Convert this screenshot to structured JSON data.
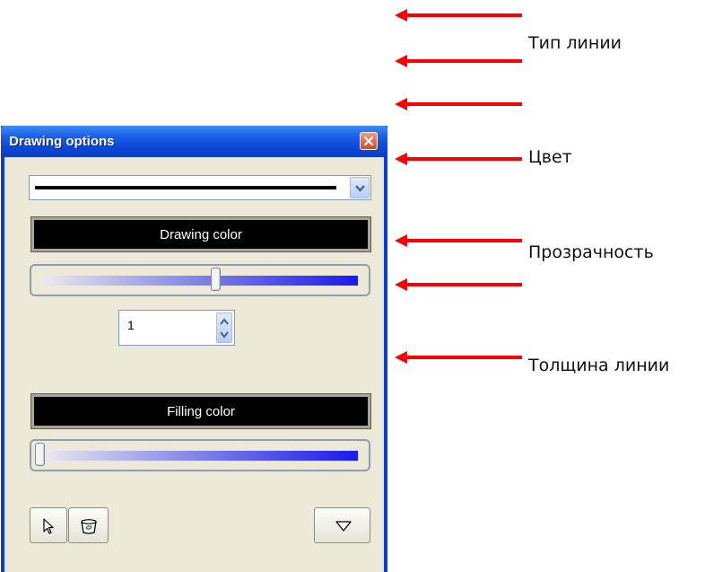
{
  "annotations": {
    "line_type": "Тип линии",
    "color": "Цвет",
    "transparency": "Прозрачность",
    "line_thickness": "Толщина линии",
    "arrow_color": "#ff0000"
  },
  "window": {
    "title": "Drawing options",
    "close_icon": "close-icon"
  },
  "line_type_combo": {
    "selected": "solid line",
    "dropdown_icon": "chevron-down-icon"
  },
  "drawing_color_button": {
    "label": "Drawing color",
    "color": "#000000"
  },
  "drawing_transparency_slider": {
    "value": 0.55
  },
  "line_thickness_spinner": {
    "value": "1"
  },
  "filling_color_button": {
    "label": "Filling color",
    "color": "#000000"
  },
  "filling_transparency_slider": {
    "value": 0.0
  },
  "tools": {
    "select_icon": "cursor-arrow-icon",
    "fill_icon": "paint-bucket-icon",
    "shape_icon": "triangle-down-icon"
  }
}
